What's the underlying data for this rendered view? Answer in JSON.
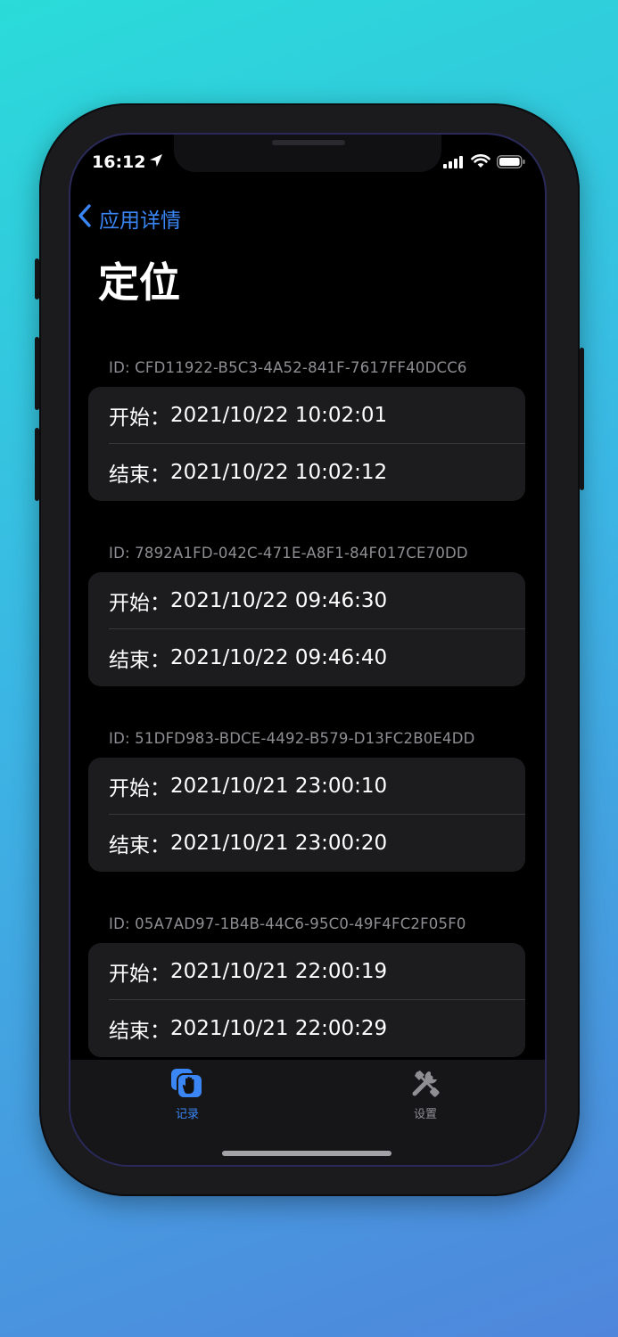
{
  "status_bar": {
    "time": "16:12"
  },
  "nav": {
    "back_label": "应用详情",
    "title": "定位"
  },
  "records": [
    {
      "id": "ID: CFD11922-B5C3-4A52-841F-7617FF40DCC6",
      "start_label": "开始：",
      "start": "2021/10/22 10:02:01",
      "end_label": "结束：",
      "end": "2021/10/22 10:02:12"
    },
    {
      "id": "ID: 7892A1FD-042C-471E-A8F1-84F017CE70DD",
      "start_label": "开始：",
      "start": "2021/10/22 09:46:30",
      "end_label": "结束：",
      "end": "2021/10/22 09:46:40"
    },
    {
      "id": "ID: 51DFD983-BDCE-4492-B579-D13FC2B0E4DD",
      "start_label": "开始：",
      "start": "2021/10/21 23:00:10",
      "end_label": "结束：",
      "end": "2021/10/21 23:00:20"
    },
    {
      "id": "ID: 05A7AD97-1B4B-44C6-95C0-49F4FC2F05F0",
      "start_label": "开始：",
      "start": "2021/10/21 22:00:19",
      "end_label": "结束：",
      "end": "2021/10/21 22:00:29"
    }
  ],
  "tabbar": {
    "tabs": [
      {
        "label": "记录",
        "icon": "hand-records-icon",
        "active": true
      },
      {
        "label": "设置",
        "icon": "tools-settings-icon",
        "active": false
      }
    ]
  },
  "colors": {
    "accent": "#3a86f5",
    "background": "#000000",
    "card": "#1c1c1e",
    "secondary_text": "#8e8e93",
    "inactive_tab": "#8e8e93"
  }
}
